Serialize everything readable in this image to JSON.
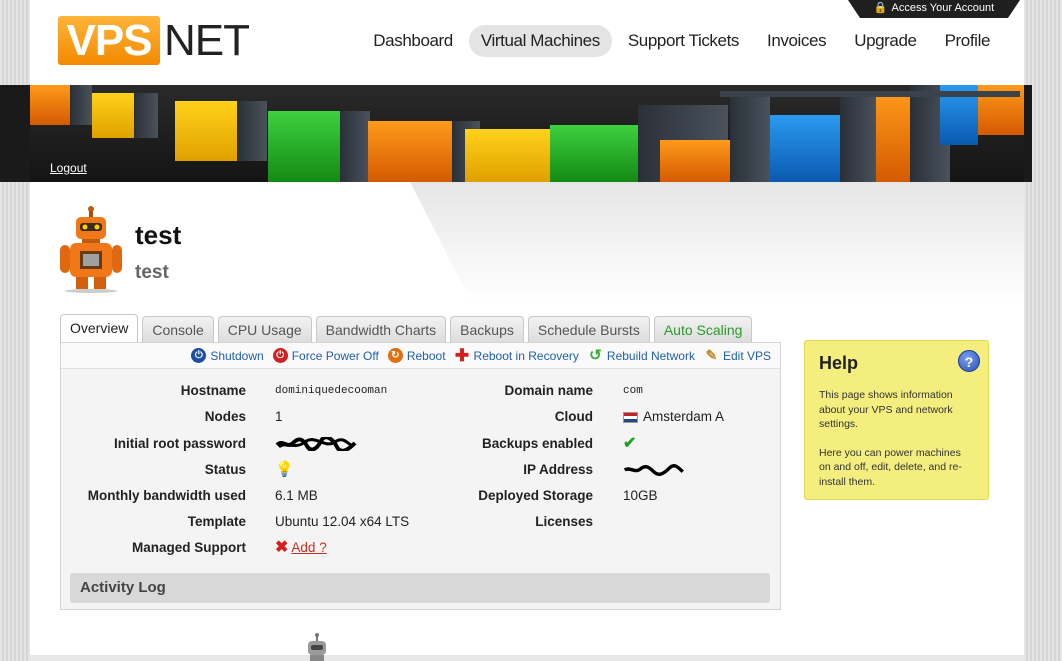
{
  "brand": {
    "logo_vps": "VPS",
    "logo_net": "NET"
  },
  "header": {
    "account_label": "Access Your Account"
  },
  "nav": [
    {
      "label": "Dashboard",
      "active": false
    },
    {
      "label": "Virtual Machines",
      "active": true
    },
    {
      "label": "Support Tickets",
      "active": false
    },
    {
      "label": "Invoices",
      "active": false
    },
    {
      "label": "Upgrade",
      "active": false
    },
    {
      "label": "Profile",
      "active": false
    }
  ],
  "banner": {
    "logout_label": "Logout"
  },
  "vm": {
    "title": "test",
    "subtitle": "test"
  },
  "tabs": [
    {
      "label": "Overview",
      "active": true
    },
    {
      "label": "Console"
    },
    {
      "label": "CPU Usage"
    },
    {
      "label": "Bandwidth Charts"
    },
    {
      "label": "Backups"
    },
    {
      "label": "Schedule Bursts"
    },
    {
      "label": "Auto Scaling",
      "accent": "#2a9a2a"
    }
  ],
  "actions": [
    {
      "label": "Shutdown",
      "icon": "power-blue-icon",
      "color": "#1f4fa0"
    },
    {
      "label": "Force Power Off",
      "icon": "power-red-icon",
      "color": "#d02020"
    },
    {
      "label": "Reboot",
      "icon": "reboot-icon",
      "color": "#e07010"
    },
    {
      "label": "Reboot in Recovery",
      "icon": "plus-red-icon",
      "color": "#d02020"
    },
    {
      "label": "Rebuild Network",
      "icon": "refresh-green-icon",
      "color": "#3aaa3a"
    },
    {
      "label": "Edit VPS",
      "icon": "pencil-icon",
      "color": "#c09030"
    }
  ],
  "details_left": [
    {
      "label": "Hostname",
      "value": "dominiquedecooman"
    },
    {
      "label": "Nodes",
      "value": "1"
    },
    {
      "label": "Initial root password",
      "value": ""
    },
    {
      "label": "Status",
      "value": ""
    },
    {
      "label": "Monthly bandwidth used",
      "value": "6.1 MB"
    },
    {
      "label": "Template",
      "value": "Ubuntu 12.04 x64 LTS"
    },
    {
      "label": "Managed Support",
      "value": "Add ?"
    }
  ],
  "details_right": [
    {
      "label": "Domain name",
      "value": "com"
    },
    {
      "label": "Cloud",
      "value": "Amsterdam A"
    },
    {
      "label": "Backups enabled",
      "value": ""
    },
    {
      "label": "IP Address",
      "value": ""
    },
    {
      "label": "Deployed Storage",
      "value": "10GB"
    },
    {
      "label": "Licenses",
      "value": ""
    }
  ],
  "activity_log": {
    "title": "Activity Log"
  },
  "help": {
    "title": "Help",
    "paragraphs": [
      "This page shows information about your VPS and network settings.",
      "Here you can power machines on and off, edit, delete, and re-install them."
    ]
  },
  "colors": {
    "brand_orange": "#f28a00",
    "link_blue": "#2060b0",
    "help_yellow": "#f3ee7e"
  }
}
